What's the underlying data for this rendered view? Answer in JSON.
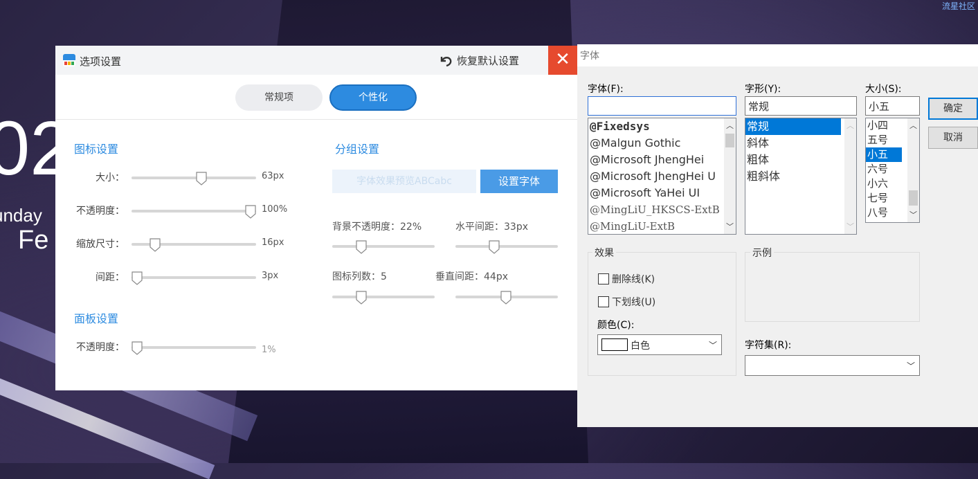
{
  "wallpaper": {
    "clock": "02",
    "day": "unday",
    "month": "Fe",
    "brand": "流星社区"
  },
  "options_dialog": {
    "title": "选项设置",
    "restore_label": "恢复默认设置",
    "close_glyph": "✕",
    "tabs": [
      {
        "label": "常规项",
        "active": false
      },
      {
        "label": "个性化",
        "active": true
      }
    ],
    "icon_section": {
      "title": "图标设置",
      "rows": [
        {
          "label": "大小：",
          "value": "63px",
          "fraction": 0.57
        },
        {
          "label": "不透明度：",
          "value": "100%",
          "fraction": 1.0
        },
        {
          "label": "缩放尺寸：",
          "value": "16px",
          "fraction": 0.16
        },
        {
          "label": "间距：",
          "value": "3px",
          "fraction": 0.0
        }
      ]
    },
    "panel_section": {
      "title": "面板设置",
      "rows": [
        {
          "label": "不透明度：",
          "value": "1%",
          "fraction": 0.0
        }
      ]
    },
    "group_section": {
      "title": "分组设置",
      "preview_text": "字体效果预览ABCabc",
      "font_button": "设置字体",
      "sliders": [
        {
          "label": "背景不透明度：22%",
          "fraction": 0.26
        },
        {
          "label": "水平间距：33px",
          "fraction": 0.36
        },
        {
          "label": "图标列数：5",
          "fraction": 0.26
        },
        {
          "label": "垂直间距：44px",
          "fraction": 0.49
        }
      ]
    }
  },
  "font_dialog": {
    "title": "字体",
    "font_label": "字体(F):",
    "font_value": "",
    "style_label": "字形(Y):",
    "style_value": "常规",
    "size_label": "大小(S):",
    "size_value": "小五",
    "fonts": [
      {
        "name": "@Fixedsys",
        "selected": false
      },
      {
        "name": "@Malgun Gothic",
        "selected": false
      },
      {
        "name": "@Microsoft JhengHei",
        "selected": false
      },
      {
        "name": "@Microsoft JhengHei U",
        "selected": false
      },
      {
        "name": "@Microsoft YaHei UI",
        "selected": false
      },
      {
        "name": "@MingLiU_HKSCS-ExtB",
        "selected": false
      },
      {
        "name": "@MingLiU-ExtB",
        "selected": false
      }
    ],
    "styles": [
      {
        "name": "常规",
        "selected": true
      },
      {
        "name": "斜体",
        "selected": false
      },
      {
        "name": "粗体",
        "selected": false
      },
      {
        "name": "粗斜体",
        "selected": false
      }
    ],
    "sizes": [
      {
        "name": "小四",
        "selected": false
      },
      {
        "name": "五号",
        "selected": false
      },
      {
        "name": "小五",
        "selected": true
      },
      {
        "name": "六号",
        "selected": false
      },
      {
        "name": "小六",
        "selected": false
      },
      {
        "name": "七号",
        "selected": false
      },
      {
        "name": "八号",
        "selected": false
      }
    ],
    "ok_button": "确定",
    "cancel_button": "取消",
    "effects_label": "效果",
    "strikeout_label": "删除线(K)",
    "underline_label": "下划线(U)",
    "color_label": "颜色(C):",
    "color_value": "白色",
    "sample_label": "示例",
    "charset_label": "字符集(R):",
    "charset_value": ""
  }
}
